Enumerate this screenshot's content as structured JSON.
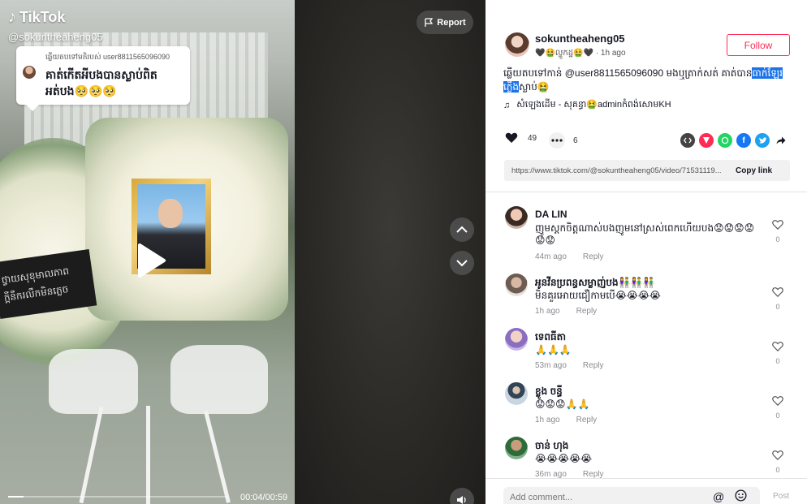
{
  "video": {
    "watermark_brand": "TikTok",
    "watermark_username": "@sokuntheaheng05",
    "reply_card": {
      "reply_to": "ឆ្លើយតបទៅមតិរបស់ user8811565096090",
      "text": "គាត់កើតអីបងបានស្លាប់ពិតអត់បង🥺🥺🥺"
    },
    "ribbon_text_line1": "ថ្វាយសុខុមាលភាព",
    "ribbon_text_line2": "ក្តីនឹករលឹកមិនភ្លេច",
    "progress": 0.07,
    "time": "00:04/00:59",
    "report_label": "Report",
    "icons": {
      "play": "play-icon",
      "flag": "flag-icon",
      "up": "chevron-up-icon",
      "down": "chevron-down-icon",
      "volume": "volume-icon"
    }
  },
  "author": {
    "username": "sokuntheaheng05",
    "nickname": "🖤🤮ល្ហួកដ្ឋ🤮🖤",
    "time_ago": "1h ago",
    "follow_label": "Follow"
  },
  "caption": {
    "prefix": "ឆ្លើយតបទៅកាន់",
    "mention": "@user8811565096090",
    "middle": "មងឬត្រាក់សត់ គាត់បាន",
    "highlight": "ធាក់ឡែរភ្លើង",
    "suffix": "ស្លាប់🤮",
    "music_icon": "♫",
    "music": "សំឡេងដើម - សុគន្ធា🤮adminកំពង់សោមKH"
  },
  "stats": {
    "likes": "49",
    "comments": "6"
  },
  "share": {
    "items": [
      "embed",
      "send",
      "whatsapp",
      "facebook",
      "twitter",
      "share"
    ],
    "colors": {
      "embed": "#444444",
      "send": "#fe2c55",
      "whatsapp": "#25d366",
      "facebook": "#1877f2",
      "twitter": "#1da1f2"
    }
  },
  "link": {
    "url": "https://www.tiktok.com/@sokuntheaheng05/video/71531119...",
    "copy_label": "Copy link"
  },
  "comments": [
    {
      "name": "DA LIN",
      "text": "ញូមស្តកចិត្តណាស់បងញូមនៅស្រស់ពេកហើយបង😟😟😟😟😟😟",
      "time": "44m ago",
      "reply": "Reply",
      "likes": "0"
    },
    {
      "name": "អូនវីនប្រពន្ធសម្លាញ់បង👫👫👫",
      "text": "មិនគួរអោយជឿកាមបើ😭😭😭😭",
      "time": "1h ago",
      "reply": "Reply",
      "likes": "0"
    },
    {
      "name": "ទេពធីតា",
      "text": "🙏🙏🙏",
      "time": "53m ago",
      "reply": "Reply",
      "likes": "0"
    },
    {
      "name": "ខ្លូង ចន្ធី",
      "text": "😟😟😟🙏🙏",
      "time": "1h ago",
      "reply": "Reply",
      "likes": "0"
    },
    {
      "name": "ចាន់ ហុង",
      "text": "😭😭😭😭😭",
      "time": "36m ago",
      "reply": "Reply",
      "likes": "0"
    }
  ],
  "footer": {
    "placeholder": "Add comment...",
    "mention_icon": "@",
    "post_label": "Post"
  }
}
